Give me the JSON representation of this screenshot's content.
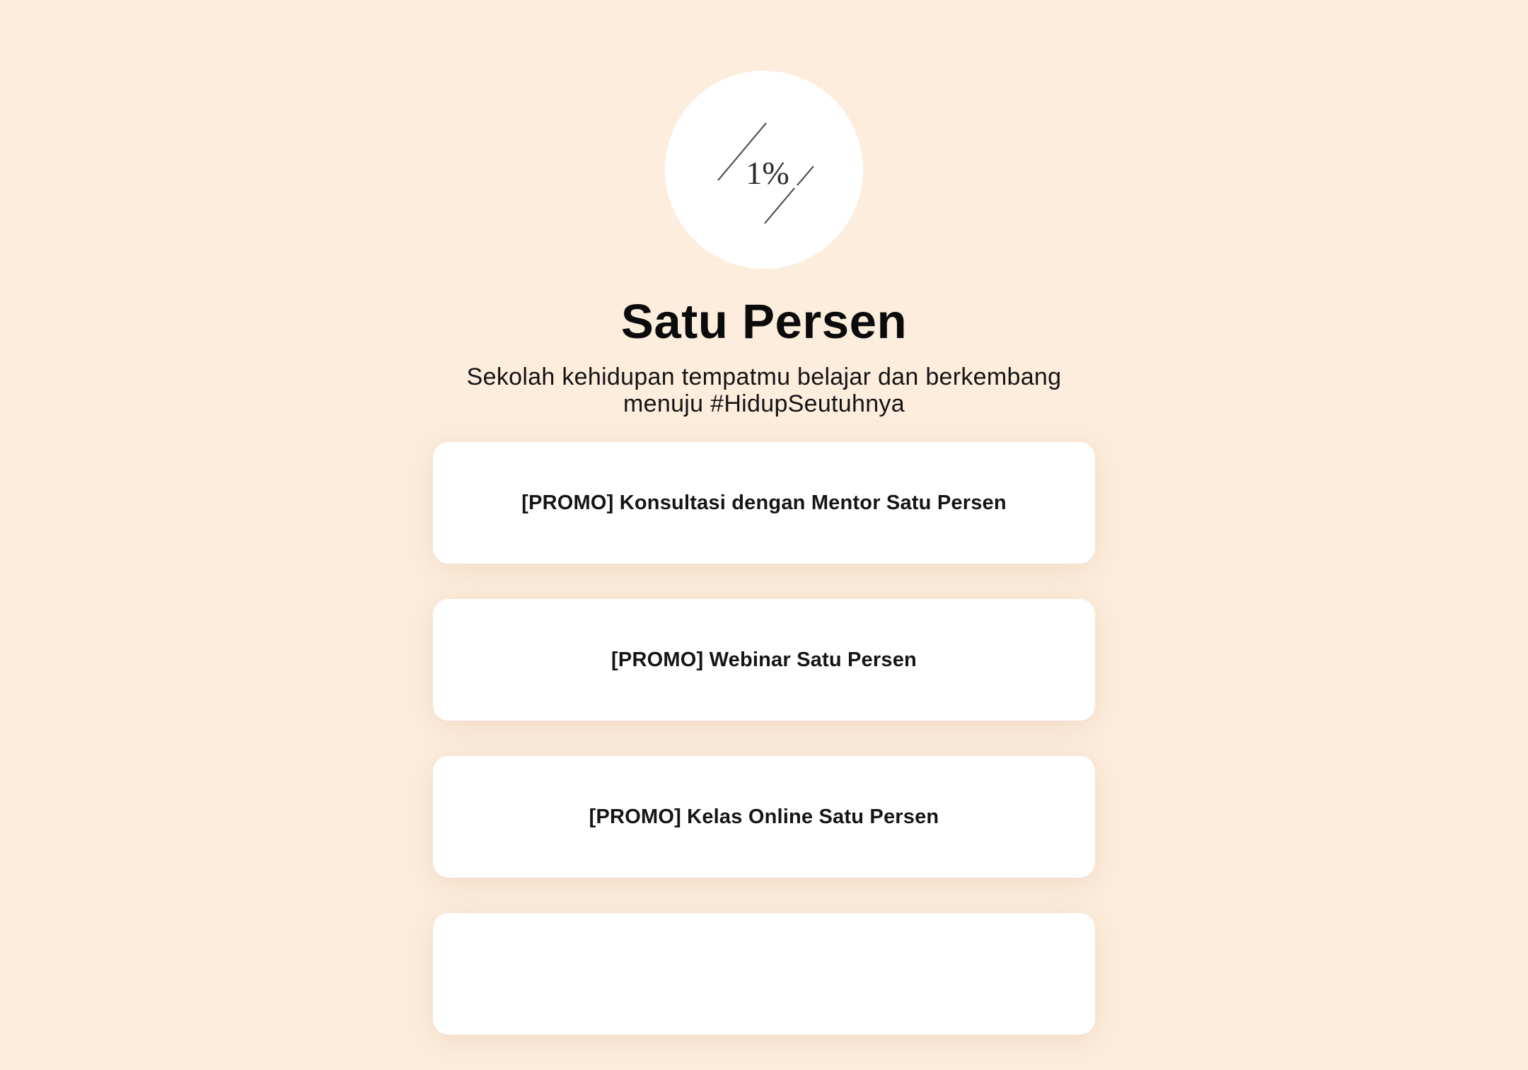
{
  "profile": {
    "avatar_logo_text": "1%",
    "title": "Satu Persen",
    "subtitle_line1": "Sekolah kehidupan tempatmu belajar dan berkembang",
    "subtitle_line2": "menuju #HidupSeutuhnya"
  },
  "links": [
    {
      "label": "[PROMO] Konsultasi dengan Mentor Satu Persen"
    },
    {
      "label": "[PROMO] Webinar Satu Persen"
    },
    {
      "label": "[PROMO] Kelas Online Satu Persen"
    },
    {
      "label": ""
    }
  ],
  "colors": {
    "background": "#FDEDDD",
    "card": "#FFFFFF",
    "text": "#0B0B0B"
  }
}
